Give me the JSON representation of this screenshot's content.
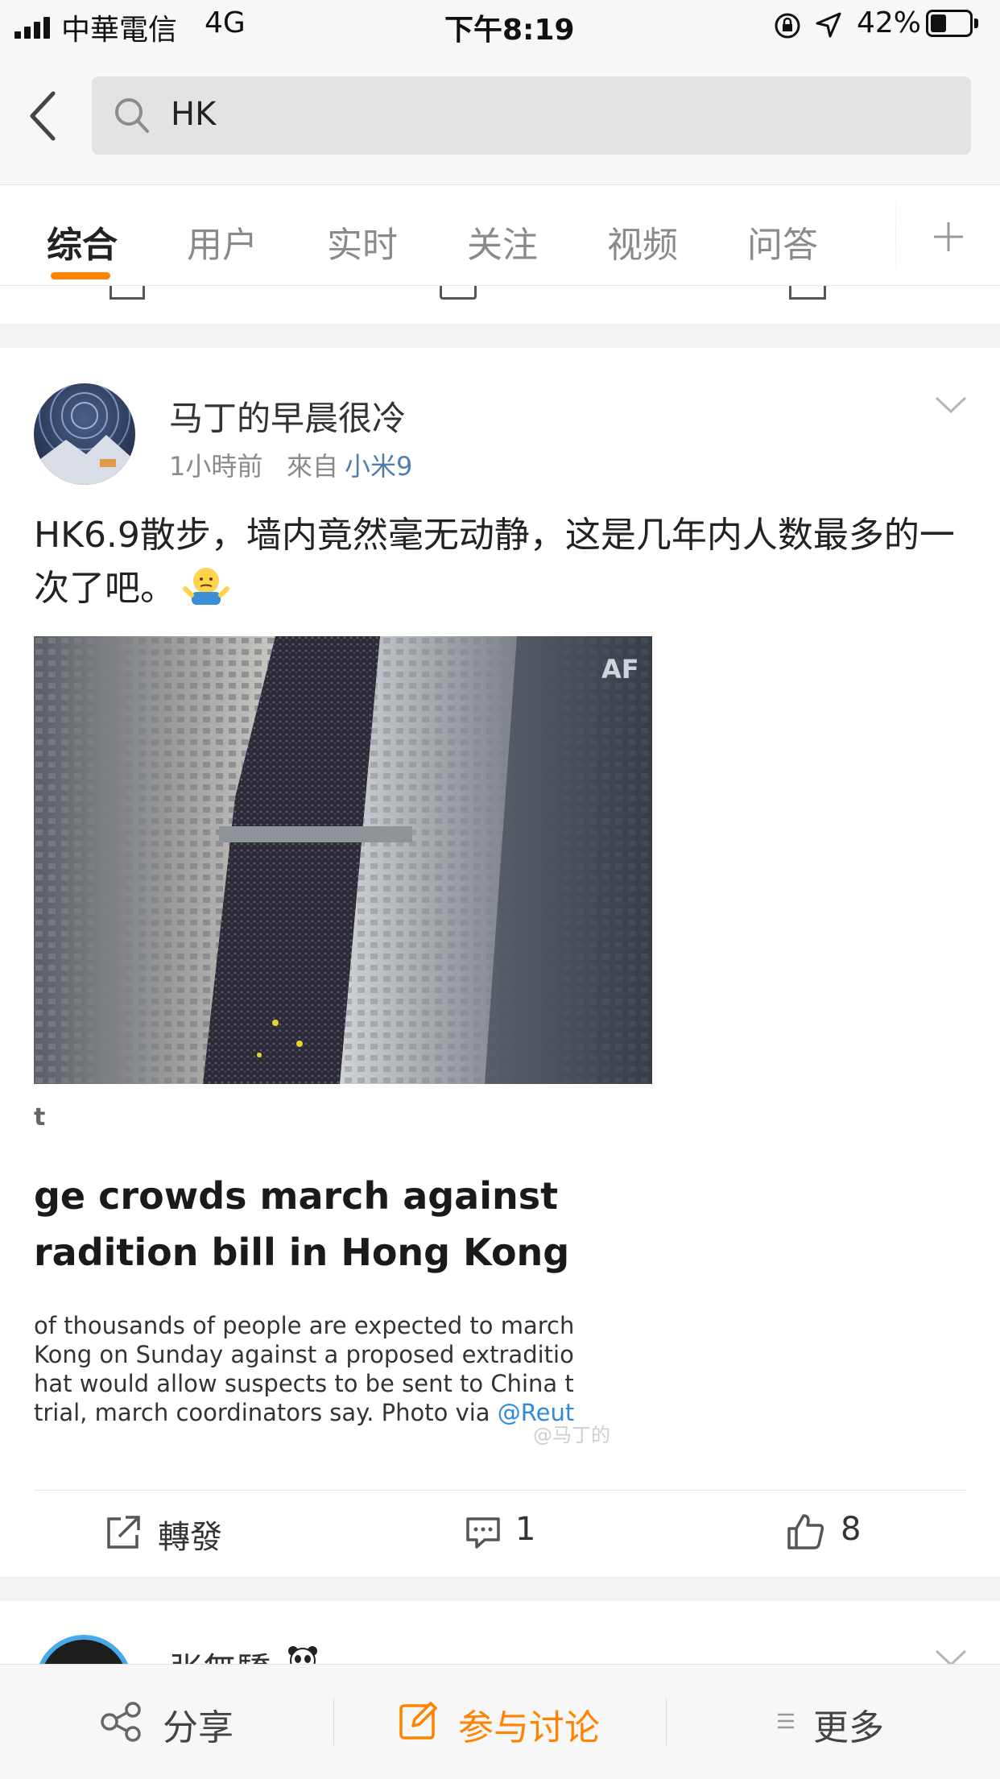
{
  "status_bar": {
    "carrier": "中華電信",
    "network": "4G",
    "time": "下午8:19",
    "battery_percent": "42%",
    "battery_level": 0.42
  },
  "search": {
    "back_icon": "chevron-left-icon",
    "query": "HK"
  },
  "tabs": {
    "items": [
      "综合",
      "用户",
      "实时",
      "关注",
      "视频",
      "问答"
    ],
    "active_index": 0,
    "add_icon": "plus-icon"
  },
  "post": {
    "author": "马丁的早晨很冷",
    "time": "1小時前",
    "source_prefix": "來自",
    "source_device": "小米9",
    "text": "HK6.9散步，墙内竟然毫无动静，这是几年内人数最多的一次了吧。",
    "emoji": "shrug-emoji-icon",
    "image_caption": {
      "kicker": "t",
      "headline_1": "ge crowds march against",
      "headline_2": "radition bill in Hong Kong",
      "body_1": "of thousands of people are expected to march",
      "body_2": "Kong on Sunday against a proposed extraditio",
      "body_3": "hat would allow suspects to be sent to China t",
      "body_4": "trial, march coordinators say. Photo via",
      "body_link": "@Reut",
      "watermark": "@马丁的",
      "corner_mark": "AF"
    },
    "actions": {
      "repost_label": "轉發",
      "comment_count": "1",
      "like_count": "8"
    }
  },
  "next_post": {
    "author": "张無驕",
    "badge": "panda-emoji-icon"
  },
  "bottom_bar": {
    "share_label": "分享",
    "discuss_label": "参与讨论",
    "more_label": "更多"
  },
  "colors": {
    "accent": "#ff8200",
    "link": "#507daf",
    "muted": "#8a8a8a"
  }
}
